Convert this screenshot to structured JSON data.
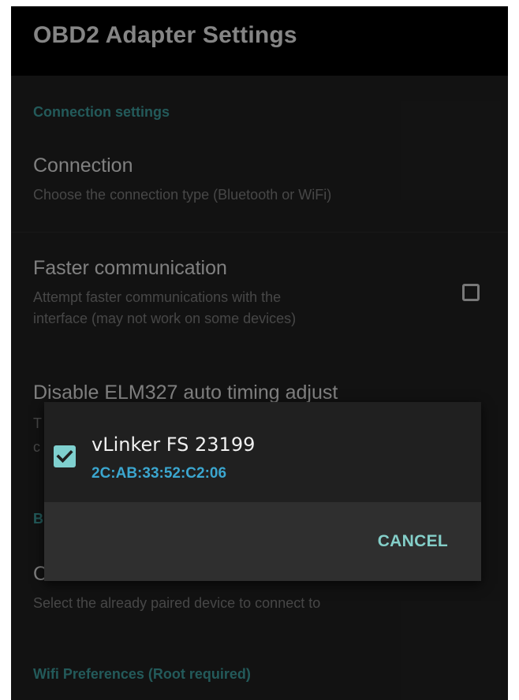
{
  "app_bar": {
    "title": "OBD2 Adapter Settings"
  },
  "sections": {
    "connection_header": "Connection settings",
    "bluetooth_header_fragment": "B",
    "wifi_header": "Wifi Preferences (Root required)"
  },
  "preferences": {
    "connection": {
      "title": "Connection",
      "summary": "Choose the connection type (Bluetooth or WiFi)"
    },
    "faster_communication": {
      "title": "Faster communication",
      "summary_line1": "Attempt faster communications with the",
      "summary_line2": "interface (may not work on some devices)",
      "checked": false
    },
    "disable_elm327": {
      "title": "Disable ELM327 auto timing adjust",
      "summary_fragment1": "T",
      "summary_fragment2": "c"
    },
    "bluetooth_device": {
      "title_fragment": "C",
      "summary": "Select the already paired device to connect to"
    }
  },
  "dialog": {
    "device_name": "vLinker FS 23199",
    "device_address": "2C:AB:33:52:C2:06",
    "device_checked": true,
    "cancel_label": "CANCEL"
  },
  "colors": {
    "accent": "#3d9b9b",
    "checkbox_fill": "#7fd0cf",
    "address_blue": "#3ba6cf",
    "cancel_text": "#84cfc9"
  }
}
